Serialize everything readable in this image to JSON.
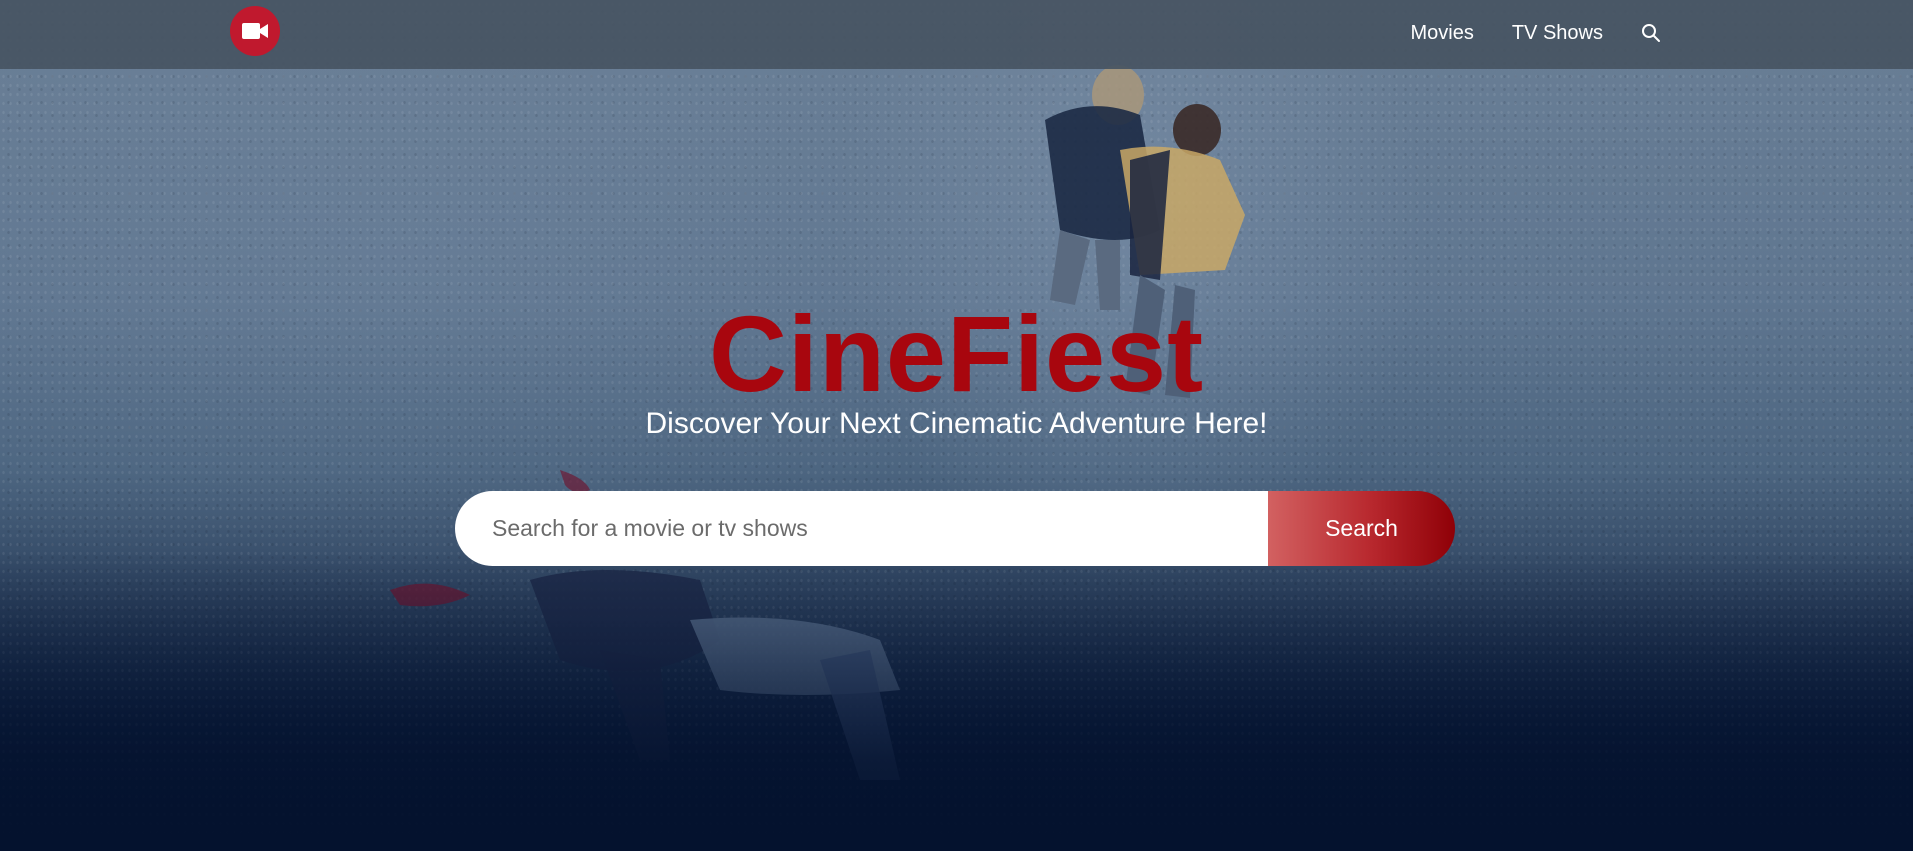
{
  "nav": {
    "logo_icon": "video-camera-icon",
    "brand_color": "#c0192e",
    "links": [
      {
        "label": "Movies"
      },
      {
        "label": "TV Shows"
      }
    ],
    "search_icon": "search-icon"
  },
  "hero": {
    "title": "CineFiest",
    "title_color": "#a8060e",
    "tagline": "Discover Your Next Cinematic Adventure Here!",
    "background": "snow-scene-image"
  },
  "search": {
    "placeholder": "Search for a movie or tv shows",
    "value": "",
    "button_label": "Search"
  }
}
